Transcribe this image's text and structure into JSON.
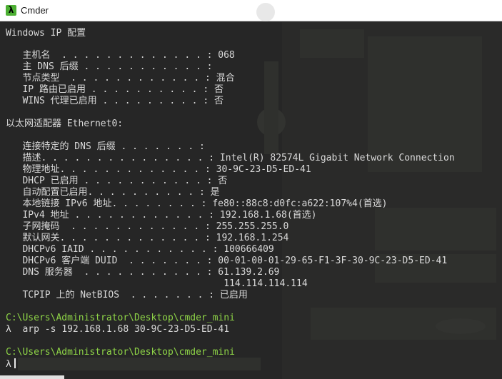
{
  "window": {
    "title": "Cmder",
    "icon_glyph": "λ",
    "icon_name": "lambda-icon"
  },
  "colors": {
    "path_green": "#8ed447",
    "text": "#d9d9d9",
    "background": "#262626"
  },
  "output_lines": [
    "Windows IP 配置",
    "",
    "   主机名  . . . . . . . . . . . . . : 068",
    "   主 DNS 后缀 . . . . . . . . . . . :",
    "   节点类型  . . . . . . . . . . . . : 混合",
    "   IP 路由已启用 . . . . . . . . . . : 否",
    "   WINS 代理已启用 . . . . . . . . . : 否",
    "",
    "以太网适配器 Ethernet0:",
    "",
    "   连接特定的 DNS 后缀 . . . . . . . :",
    "   描述. . . . . . . . . . . . . . . : Intel(R) 82574L Gigabit Network Connection",
    "   物理地址. . . . . . . . . . . . . : 30-9C-23-D5-ED-41",
    "   DHCP 已启用 . . . . . . . . . . . : 否",
    "   自动配置已启用. . . . . . . . . . : 是",
    "   本地链接 IPv6 地址. . . . . . . . : fe80::88c8:d0fc:a622:107%4(首选)",
    "   IPv4 地址 . . . . . . . . . . . . : 192.168.1.68(首选)",
    "   子网掩码  . . . . . . . . . . . . : 255.255.255.0",
    "   默认网关. . . . . . . . . . . . . : 192.168.1.254",
    "   DHCPv6 IAID . . . . . . . . . . . : 100666409",
    "   DHCPv6 客户端 DUID  . . . . . . . : 00-01-00-01-29-65-F1-3F-30-9C-23-D5-ED-41",
    "   DNS 服务器  . . . . . . . . . . . : 61.139.2.69",
    "                                       114.114.114.114",
    "   TCPIP 上的 NetBIOS  . . . . . . . : 已启用"
  ],
  "prompt1": {
    "path": "C:\\Users\\Administrator\\Desktop\\cmder_mini",
    "lambda": "λ",
    "command": "arp -s 192.168.1.68 30-9C-23-D5-ED-41"
  },
  "prompt2": {
    "path": "C:\\Users\\Administrator\\Desktop\\cmder_mini",
    "lambda": "λ",
    "command": ""
  }
}
